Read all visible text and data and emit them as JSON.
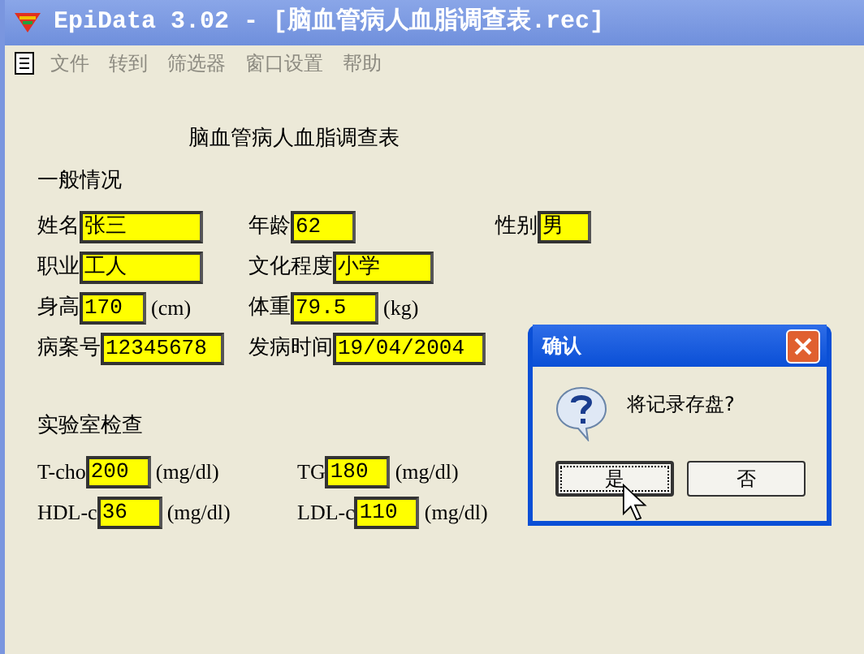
{
  "window": {
    "title": "EpiData 3.02 - [脑血管病人血脂调查表.rec]"
  },
  "menu": [
    "文件",
    "转到",
    "筛选器",
    "窗口设置",
    "帮助"
  ],
  "form": {
    "title": "脑血管病人血脂调查表",
    "sections": [
      {
        "heading": "一般情况",
        "rows": [
          [
            {
              "label": "姓名",
              "value": "张三"
            },
            {
              "label": "年龄",
              "value": "62"
            },
            {
              "label": "性别",
              "value": "男"
            }
          ],
          [
            {
              "label": "职业",
              "value": "工人"
            },
            {
              "label": "文化程度",
              "value": "小学"
            }
          ],
          [
            {
              "label": "身高",
              "value": "170",
              "unit": "(cm)"
            },
            {
              "label": "体重",
              "value": "79.5",
              "unit": "(kg)"
            }
          ],
          [
            {
              "label": "病案号",
              "value": "12345678"
            },
            {
              "label": "发病时间",
              "value": "19/04/2004"
            }
          ]
        ]
      },
      {
        "heading": "实验室检查",
        "rows": [
          [
            {
              "label": "T-cho",
              "value": "200",
              "unit": "(mg/dl)"
            },
            {
              "label": "TG",
              "value": "180",
              "unit": "(mg/dl)"
            }
          ],
          [
            {
              "label": "HDL-c",
              "value": "36",
              "unit": "(mg/dl)"
            },
            {
              "label": "LDL-c",
              "value": "110",
              "unit": "(mg/dl)"
            }
          ]
        ]
      }
    ]
  },
  "dialog": {
    "title": "确认",
    "message": "将记录存盘?",
    "buttons": [
      {
        "label": "是",
        "focused": true
      },
      {
        "label": "否",
        "focused": false
      }
    ]
  }
}
